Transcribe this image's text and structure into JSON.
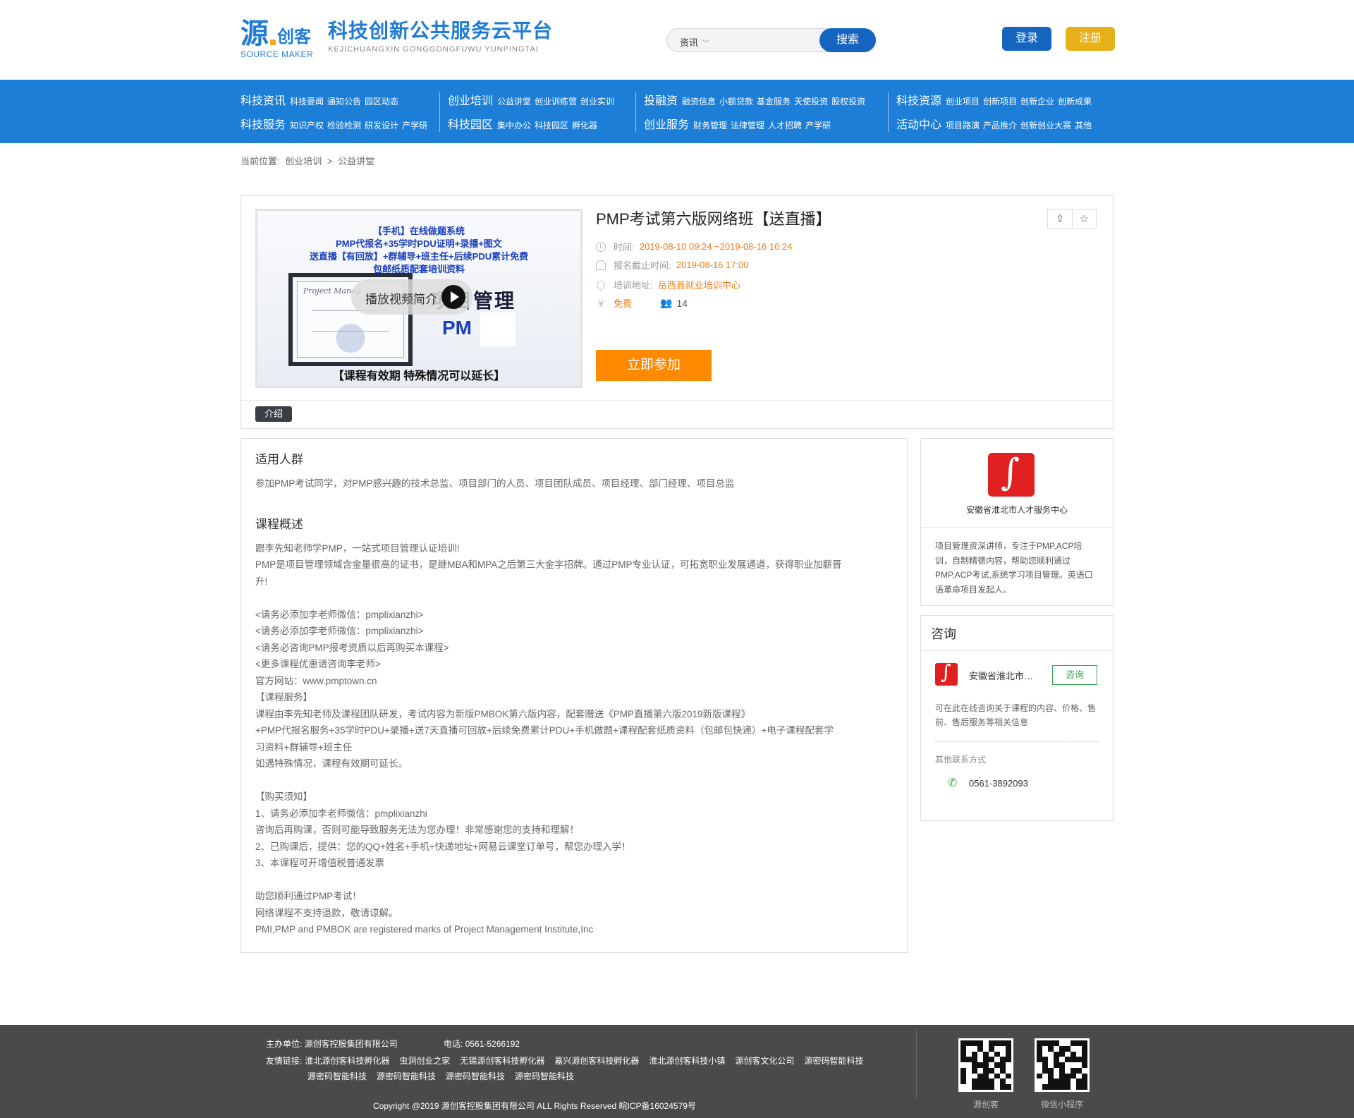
{
  "header": {
    "logo_mark": "源",
    "logo_brand": "创客",
    "logo_en": "SOURCE MAKER",
    "logo_title": "科技创新公共服务云平台",
    "logo_pinyin": "KEJICHUANGXIN GONGGONGFUWU YUNPINGTAI",
    "search_category": "资讯",
    "search_placeholder": "",
    "search_button": "搜索",
    "login": "登录",
    "register": "注册"
  },
  "nav": {
    "columns": [
      {
        "rows": [
          {
            "main": "科技资讯",
            "subs": [
              "科技要闻",
              "通知公告",
              "园区动态"
            ]
          },
          {
            "main": "科技服务",
            "subs": [
              "知识产权",
              "检验检测",
              "研发设计",
              "产学研"
            ]
          }
        ]
      },
      {
        "rows": [
          {
            "main": "创业培训",
            "subs": [
              "公益讲堂",
              "创业训练营",
              "创业实训"
            ]
          },
          {
            "main": "科技园区",
            "subs": [
              "集中办公",
              "科技园区",
              "孵化器"
            ]
          }
        ]
      },
      {
        "rows": [
          {
            "main": "投融资",
            "subs": [
              "融资信息",
              "小额贷款",
              "基金服务",
              "天使投资",
              "股权投资"
            ]
          },
          {
            "main": "创业服务",
            "subs": [
              "财务管理",
              "法律管理",
              "人才招聘",
              "产学研"
            ]
          }
        ]
      },
      {
        "rows": [
          {
            "main": "科技资源",
            "subs": [
              "创业项目",
              "创新项目",
              "创新企业",
              "创新成果"
            ]
          },
          {
            "main": "活动中心",
            "subs": [
              "项目路演",
              "产品推介",
              "创新创业大赛",
              "其他"
            ]
          }
        ]
      }
    ]
  },
  "breadcrumb": {
    "label": "当前位置:",
    "items": [
      "创业培训",
      ">",
      "公益讲堂"
    ]
  },
  "course": {
    "cover": {
      "lines": [
        "【手机】在线做题系统",
        "PMP代报名+35学时PDU证明+录播+图文",
        "送直播【有回放】+群辅导+班主任+后续PDU累计免费",
        "包邮纸质配套培训资料"
      ],
      "cert_head": "Project Manag",
      "big_text": "项目管理",
      "pm_text": "PM",
      "bottom": "【课程有效期 特殊情况可以延长】",
      "play_label": "播放视频简介"
    },
    "title": "PMP考试第六版网络班【送直播】",
    "time_label": "时间:",
    "time_value": "2019-08-10 09:24 ~2019-08-16 16:24",
    "deadline_label": "报名截止时间:",
    "deadline_value": "2019-08-16 17:00",
    "address_label": "培训地址:",
    "address_value": "岳西县就业培训中心",
    "price_icon": "¥",
    "price": "免费",
    "participants": "14",
    "join_button": "立即参加",
    "tab_intro": "介绍"
  },
  "article": {
    "audience_title": "适用人群",
    "audience_text": "参加PMP考试同学，对PMP感兴趣的技术总监、项目部门的人员、项目团队成员、项目经理、部门经理、项目总监",
    "overview_title": "课程概述",
    "overview_lines": [
      "跟李先知老师学PMP，一站式项目管理认证培训!",
      "PMP是项目管理领域含金量很高的证书，是继MBA和MPA之后第三大金字招牌。通过PMP专业认证，可拓宽职业发展通道，获得职业加薪晋",
      "升!",
      "",
      "<请务必添加李老师微信：pmplixianzhi>",
      "<请务必添加李老师微信：pmplixianzhi>",
      "<请务必咨询PMP报考资质以后再购买本课程>",
      "<更多课程优惠请咨询李老师>",
      "官方网站：www.pmptown.cn",
      "【课程服务】",
      "课程由李先知老师及课程团队研发，考试内容为新版PMBOK第六版内容，配套赠送《PMP直播第六版2019新版课程》",
      "+PMP代报名服务+35学时PDU+录播+送7天直播可回放+后续免费累计PDU+手机做题+课程配套纸质资料（包邮包快递）+电子课程配套学",
      "习资料+群辅导+班主任",
      "如遇特殊情况，课程有效期可延长。",
      "",
      "【购买须知】",
      "1、请务必添加李老师微信：pmplixianzhi",
      "咨询后再购课，否则可能导致服务无法为您办理！非常感谢您的支持和理解！",
      "2、已购课后，提供：您的QQ+姓名+手机+快递地址+网易云课堂订单号，帮您办理入学！",
      "3、本课程可开增值税普通发票",
      "",
      "助您顺利通过PMP考试！",
      "网络课程不支持退款，敬请谅解。",
      "PMI,PMP and PMBOK are registered marks of Project Management Institute,Inc"
    ]
  },
  "sidebar": {
    "org_name": "安徽省淮北市人才服务中心",
    "org_desc": "项目管理资深讲师，专注于PMP,ACP培训，自制精德内容，帮助您顺利通过PMP,ACP考试,系统学习项目管理。英语口语革命项目发起人。",
    "consult_title": "咨询",
    "consult_org": "安徽省淮北市人才服务中心",
    "consult_button": "咨询",
    "consult_tip": "可在此在线咨询关于课程的内容、价格、售前、售后服务等相关信息",
    "other_contact": "其他联系方式",
    "phone": "0561-3892093"
  },
  "footer": {
    "host_label": "主办单位:",
    "host": "源创客控股集团有限公司",
    "tel_label": "电话:",
    "tel": "0561-5266192",
    "links_label": "友情链接:",
    "links_row1": [
      "淮北源创客科技孵化器",
      "虫洞创业之家",
      "无锡源创客科技孵化器",
      "嘉兴源创客科技孵化器",
      "淮北源创客科技小镇",
      "源创客文化公司",
      "源密码智能科技"
    ],
    "links_row2": [
      "源密码智能科技",
      "源密码智能科技",
      "源密码智能科技",
      "源密码智能科技"
    ],
    "copyright": "Copyright @2019 源创客控股集团有限公司 ALL Rights Reserved 皖ICP备16024579号",
    "qr1_label": "源创客",
    "qr2_label": "微信小程序"
  },
  "colors": {
    "brand_blue": "#1c7ed6",
    "button_blue": "#1565c0",
    "register_gold": "#e8b018",
    "accent_orange": "#ff8a00",
    "consult_green": "#2fa84f",
    "footer_bg": "#4a4a4a"
  }
}
